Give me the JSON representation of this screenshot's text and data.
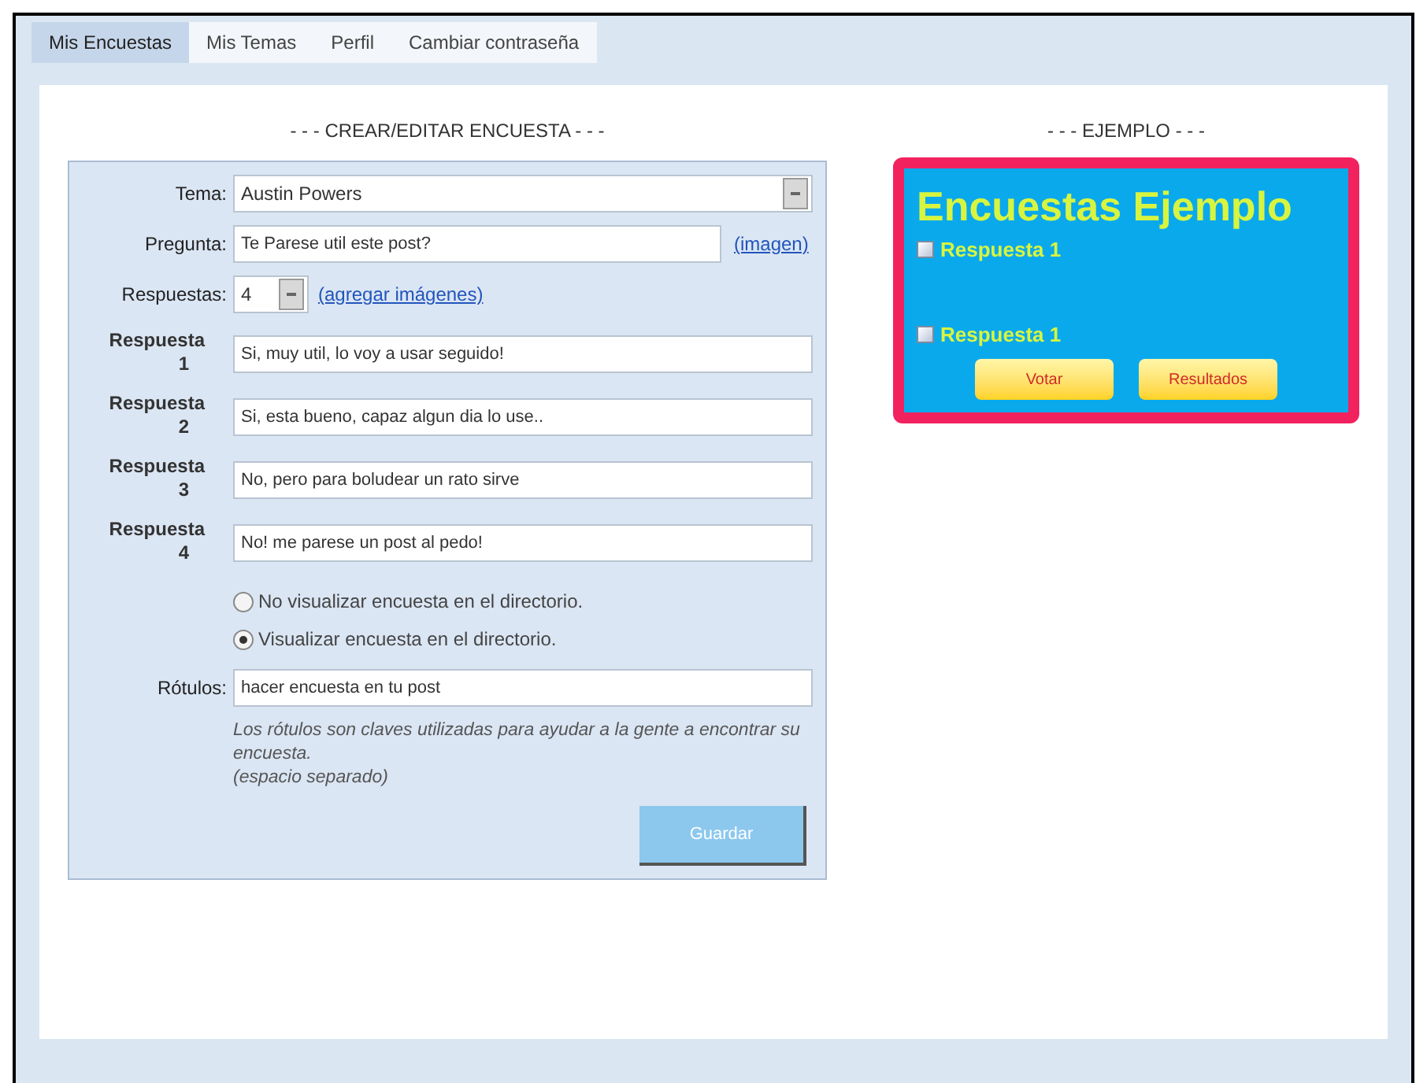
{
  "tabs": [
    {
      "label": "Mis Encuestas",
      "selected": true
    },
    {
      "label": "Mis Temas",
      "selected": false
    },
    {
      "label": "Perfil",
      "selected": false
    },
    {
      "label": "Cambiar contraseña",
      "selected": false
    }
  ],
  "form": {
    "heading": "- - - CREAR/EDITAR ENCUESTA - - -",
    "tema": {
      "label": "Tema:",
      "value": "Austin Powers"
    },
    "pregunta": {
      "label": "Pregunta:",
      "value": "Te Parese util este post?",
      "link": "(imagen)"
    },
    "respuestas": {
      "label": "Respuestas:",
      "value": "4",
      "link": "(agregar imágenes)"
    },
    "answers": [
      {
        "label": "Respuesta",
        "number": "1",
        "value": "Si, muy util, lo voy a usar seguido!"
      },
      {
        "label": "Respuesta",
        "number": "2",
        "value": "Si, esta bueno, capaz algun dia lo use.."
      },
      {
        "label": "Respuesta",
        "number": "3",
        "value": "No, pero para boludear un rato sirve"
      },
      {
        "label": "Respuesta",
        "number": "4",
        "value": "No! me parese un post al pedo!"
      }
    ],
    "visibility": [
      {
        "label": "No visualizar encuesta en el directorio.",
        "selected": false
      },
      {
        "label": "Visualizar encuesta en el directorio.",
        "selected": true
      }
    ],
    "rotulos": {
      "label": "Rótulos:",
      "value": "hacer encuesta en tu post"
    },
    "hint": [
      "Los rótulos son claves utilizadas para ayudar a la gente a encontrar su encuesta.",
      "(espacio separado)"
    ],
    "save": "Guardar"
  },
  "example": {
    "heading": "- - - EJEMPLO - - -",
    "title": "Encuestas Ejemplo",
    "options": [
      {
        "label": "Respuesta 1",
        "checked": false
      },
      {
        "label": "Respuesta 1",
        "checked": false
      }
    ],
    "buttons": [
      "Votar",
      "Resultados"
    ]
  }
}
